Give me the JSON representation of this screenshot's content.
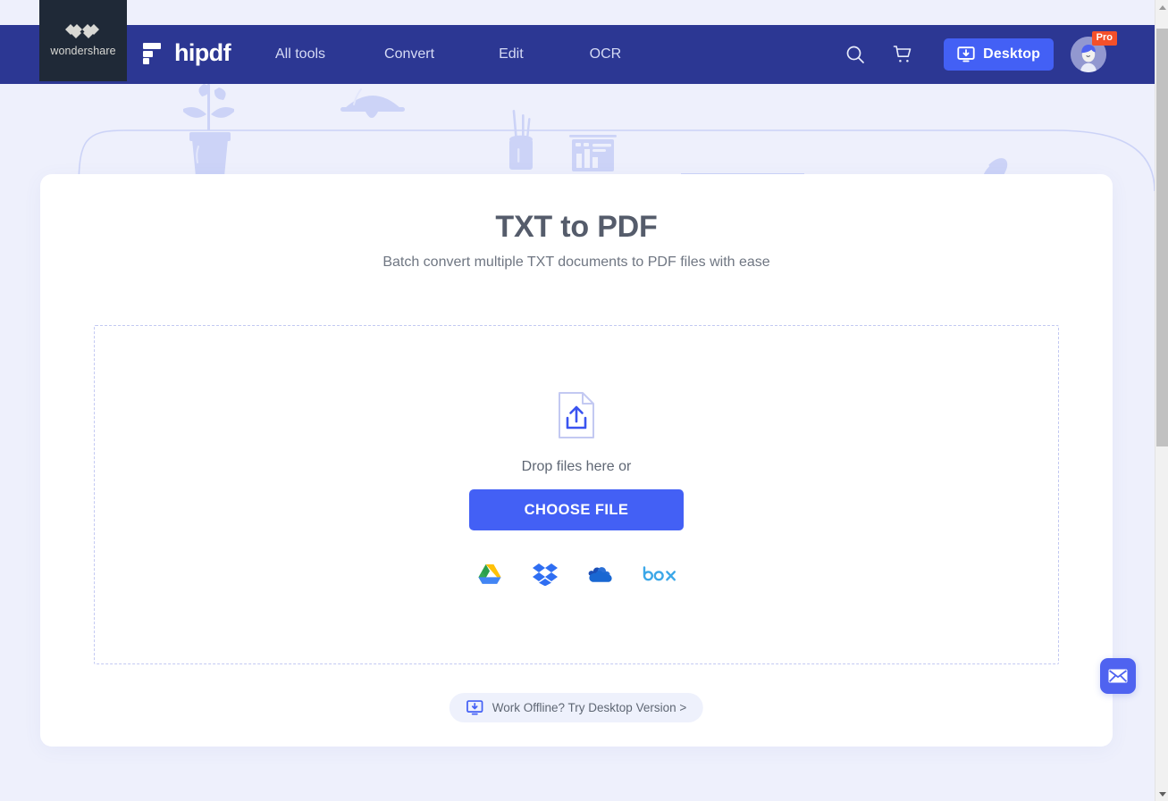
{
  "brand": {
    "wondershare_name": "wondershare",
    "wondershare_mark": "wondershare-w-icon",
    "product_name": "hipdf",
    "product_mark": "hipdf-logo-icon"
  },
  "nav": {
    "links": [
      {
        "label": "All tools",
        "name": "nav-link-all-tools"
      },
      {
        "label": "Convert",
        "name": "nav-link-convert"
      },
      {
        "label": "Edit",
        "name": "nav-link-edit"
      },
      {
        "label": "OCR",
        "name": "nav-link-ocr"
      }
    ],
    "search_icon": "search-icon",
    "cart_icon": "shopping-cart-icon",
    "desktop_button_label": "Desktop",
    "desktop_button_icon": "download-to-monitor-icon",
    "avatar_icon": "user-avatar-icon",
    "pro_badge": "Pro",
    "accent_color": "#4360f5",
    "navbar_color": "#2c3793",
    "badge_color": "#f4502a"
  },
  "hero": {
    "illustration_items": [
      "potted-plant-illustration",
      "pendant-lamp-illustration",
      "pencil-cup-illustration",
      "small-chart-board-illustration",
      "framed-picture-illustration",
      "dashboard-chart-illustration",
      "document-page-illustration",
      "quill-inkpot-illustration"
    ],
    "illustration_color": "#ccd3f7",
    "background_color": "#eef0fc"
  },
  "main": {
    "title": "TXT to PDF",
    "subtitle": "Batch convert multiple TXT documents to PDF files with ease",
    "dropzone": {
      "upload_icon": "file-upload-icon",
      "drop_text": "Drop files here or",
      "choose_file_label": "CHOOSE FILE",
      "cloud_sources": [
        {
          "label": "Google Drive",
          "name": "google-drive-icon"
        },
        {
          "label": "Dropbox",
          "name": "dropbox-icon"
        },
        {
          "label": "OneDrive",
          "name": "onedrive-icon"
        },
        {
          "label": "Box",
          "name": "box-icon"
        }
      ]
    },
    "offline_pill": {
      "label": "Work Offline? Try Desktop Version >",
      "icon": "download-to-monitor-icon"
    }
  },
  "floating": {
    "mail_icon": "envelope-icon",
    "mail_color": "#4f63f0"
  },
  "scrollbar": {
    "up_arrow_icon": "scroll-up-arrow-icon",
    "down_arrow_icon": "scroll-down-arrow-icon",
    "thumb": "scrollbar-thumb"
  }
}
